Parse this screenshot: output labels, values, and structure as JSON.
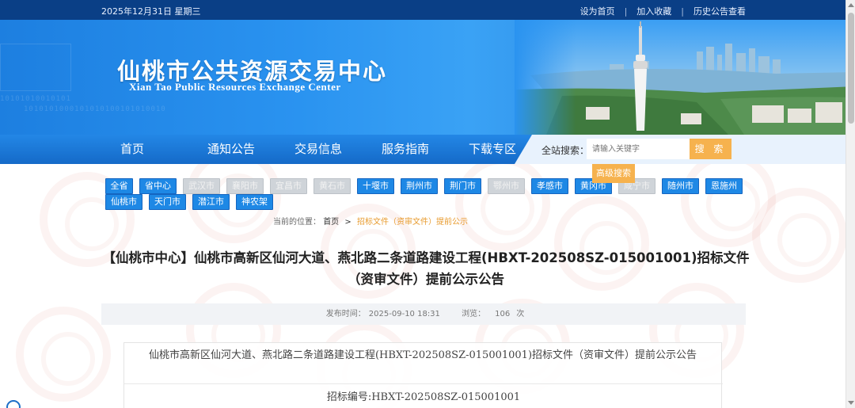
{
  "topbar": {
    "date": "2025年12月31日 星期三",
    "links": [
      "设为首页",
      "加入收藏",
      "历史公告查看"
    ]
  },
  "header": {
    "title": "仙桃市公共资源交易中心",
    "subtitle": "Xian Tao Public Resources Exchange Center"
  },
  "nav": {
    "items": [
      "首页",
      "通知公告",
      "交易信息",
      "服务指南",
      "下载专区"
    ]
  },
  "search": {
    "label": "全站搜索：",
    "placeholder": "请输入关键字",
    "button": "搜 索",
    "advanced": "高级搜索"
  },
  "regions": [
    {
      "label": "全省",
      "enabled": true
    },
    {
      "label": "省中心",
      "enabled": true
    },
    {
      "label": "武汉市",
      "enabled": false
    },
    {
      "label": "襄阳市",
      "enabled": false
    },
    {
      "label": "宜昌市",
      "enabled": false
    },
    {
      "label": "黄石市",
      "enabled": false
    },
    {
      "label": "十堰市",
      "enabled": true
    },
    {
      "label": "荆州市",
      "enabled": true
    },
    {
      "label": "荆门市",
      "enabled": true
    },
    {
      "label": "鄂州市",
      "enabled": false
    },
    {
      "label": "孝感市",
      "enabled": true
    },
    {
      "label": "黄冈市",
      "enabled": true
    },
    {
      "label": "咸宁市",
      "enabled": false
    },
    {
      "label": "随州市",
      "enabled": true
    },
    {
      "label": "恩施州",
      "enabled": true
    },
    {
      "label": "仙桃市",
      "enabled": true
    },
    {
      "label": "天门市",
      "enabled": true
    },
    {
      "label": "潜江市",
      "enabled": true
    },
    {
      "label": "神农架",
      "enabled": true
    }
  ],
  "breadcrumb": {
    "here": "当前的位置：",
    "home": "首页",
    "sep": ">",
    "current": "招标文件（资审文件）提前公示"
  },
  "article": {
    "title": "【仙桃市中心】仙桃市高新区仙河大道、燕北路二条道路建设工程(HBXT-202508SZ-015001001)招标文件（资审文件）提前公示公告",
    "publish_label": "发布时间：",
    "publish_time": "2025-09-10 18:31",
    "views_label": "浏览：",
    "views": "106",
    "views_unit": "次",
    "content_header": "仙桃市高新区仙河大道、燕北路二条道路建设工程(HBXT-202508SZ-015001001)招标文件（资审文件）提前公示公告",
    "bid_number": "招标编号:HBXT-202508SZ-015001001"
  },
  "colors": {
    "topbar": "#0a3f86",
    "nav": "#1a78d8",
    "accent": "#f6b24e",
    "region_active": "#1e88e5",
    "region_disabled": "#cfd4d9"
  }
}
